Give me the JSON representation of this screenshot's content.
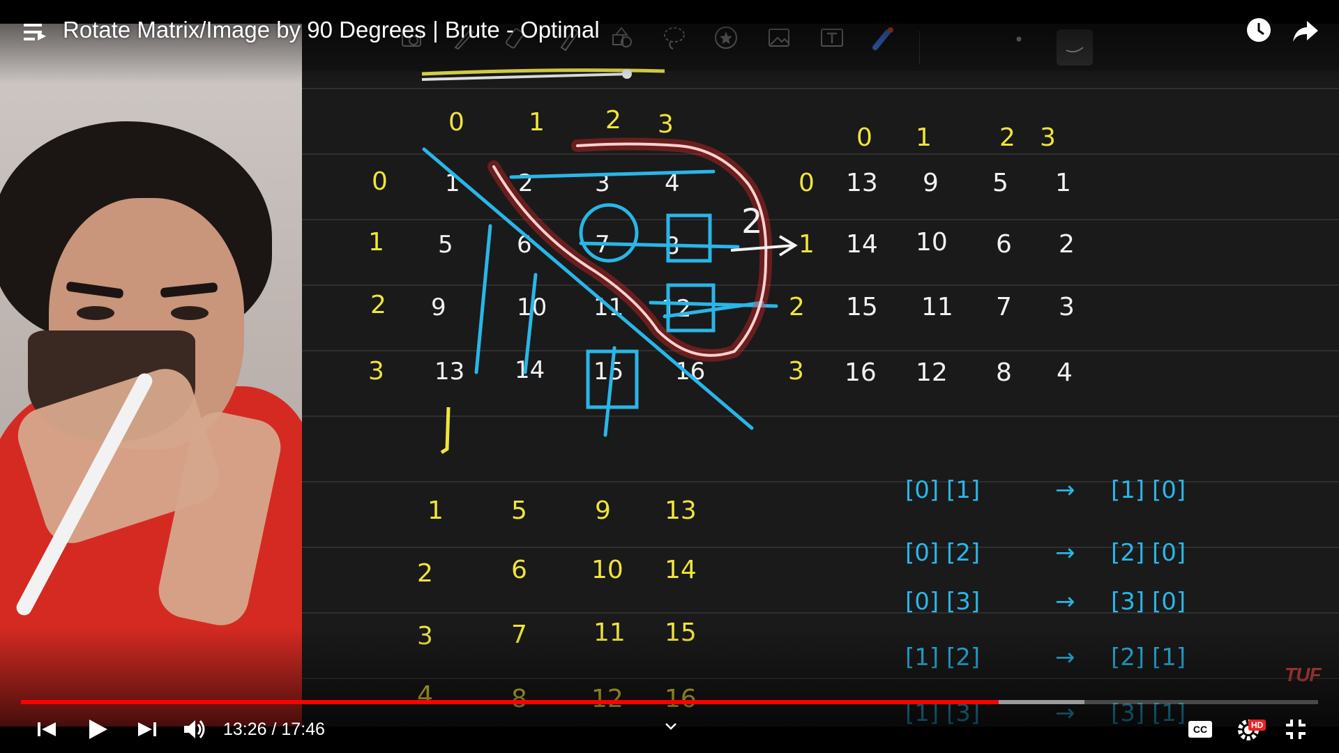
{
  "player": {
    "title": "Rotate Matrix/Image by 90 Degrees | Brute - Optimal",
    "time": "13:26 / 17:46",
    "progress_played": 0.754,
    "progress_loaded": 0.82,
    "accent_color": "#ff0000",
    "hd_badge": "HD",
    "cc_label": "CC",
    "icons": [
      "playlist-icon",
      "watch-later-icon",
      "share-icon",
      "previous-icon",
      "play-icon",
      "next-icon",
      "volume-icon",
      "chevron-down-icon",
      "captions-icon",
      "settings-icon",
      "exit-fullscreen-icon"
    ]
  },
  "watermark": "TUF",
  "board": {
    "toolbar_icons": [
      "zoom-icon",
      "pen-icon",
      "eraser-icon",
      "highlighter-icon",
      "shapes-icon",
      "lasso-icon",
      "sticker-icon",
      "image-icon",
      "text-icon",
      "laser-icon",
      "dot-icon",
      "stroke-icon"
    ],
    "left_matrix": {
      "col_headers": [
        "0",
        "1",
        "2",
        "3"
      ],
      "row_headers": [
        "0",
        "1",
        "2",
        "3"
      ],
      "rows": [
        [
          "1",
          "2",
          "3",
          "4"
        ],
        [
          "5",
          "6",
          "7",
          "8"
        ],
        [
          "9",
          "10",
          "11",
          "12"
        ],
        [
          "13",
          "14",
          "15",
          "16"
        ]
      ]
    },
    "right_matrix": {
      "col_headers": [
        "0",
        "1",
        "2",
        "3"
      ],
      "row_headers": [
        "0",
        "1",
        "2",
        "3"
      ],
      "rows": [
        [
          "13",
          "9",
          "5",
          "1"
        ],
        [
          "14",
          "10",
          "6",
          "2"
        ],
        [
          "15",
          "11",
          "7",
          "3"
        ],
        [
          "16",
          "12",
          "8",
          "4"
        ]
      ]
    },
    "arrow_label": "2",
    "transposed": {
      "rows": [
        [
          "1",
          "5",
          "9",
          "13"
        ],
        [
          "2",
          "6",
          "10",
          "14"
        ],
        [
          "3",
          "7",
          "11",
          "15"
        ],
        [
          "4",
          "8",
          "12",
          "16"
        ]
      ]
    },
    "swaps": [
      {
        "left": "[0] [1]",
        "right": "[1] [0]"
      },
      {
        "left": "[0] [2]",
        "right": "[2] [0]"
      },
      {
        "left": "[0] [3]",
        "right": "[3] [0]"
      },
      {
        "left": "[1] [2]",
        "right": "[2] [1]"
      },
      {
        "left": "[1] [3]",
        "right": "[3] [1]"
      }
    ]
  }
}
